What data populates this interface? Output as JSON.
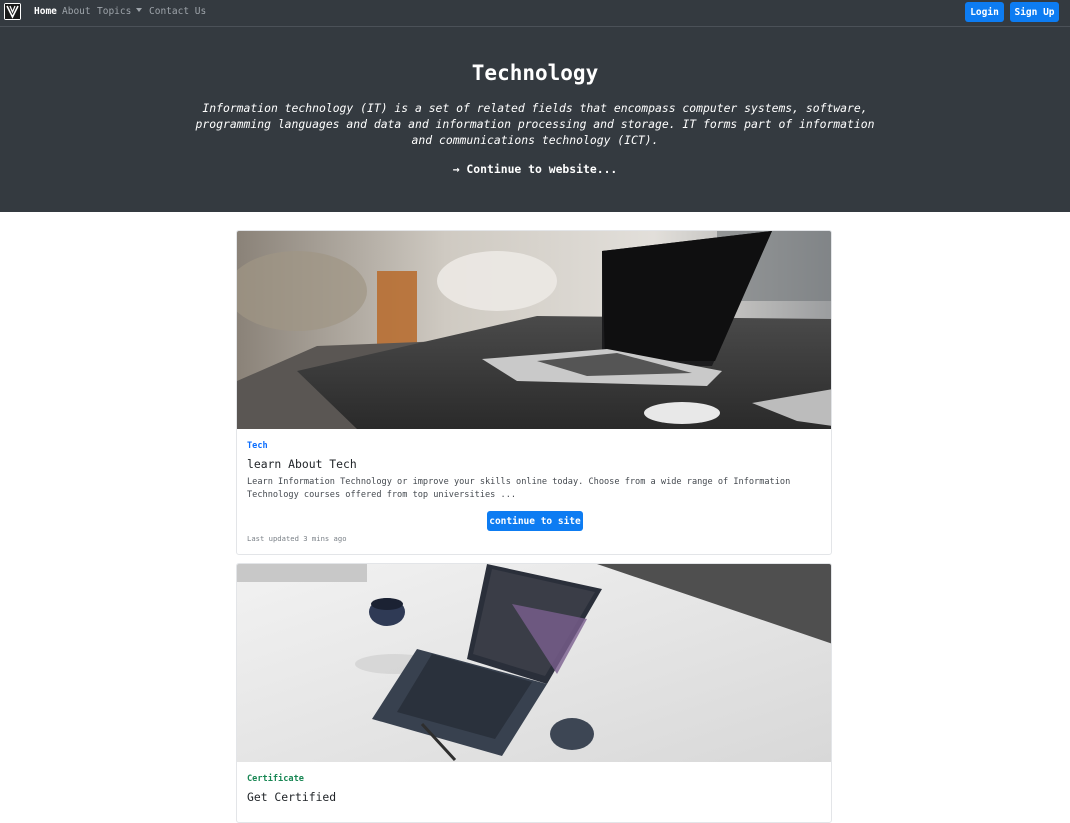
{
  "navbar": {
    "links": [
      {
        "label": "Home"
      },
      {
        "label": "About"
      },
      {
        "label": "Topics"
      },
      {
        "label": "Contact Us"
      }
    ],
    "login_label": "Login",
    "signup_label": "Sign Up"
  },
  "hero": {
    "title": "Technology",
    "lead": "Information technology (IT) is a set of related fields that encompass computer systems, software, programming languages and data and information processing and storage. IT forms part of information and communications technology (ICT).",
    "link_label": "→ Continue to website..."
  },
  "cards": [
    {
      "tag": "Tech",
      "tag_color": "#0d6efd",
      "title": "learn About Tech",
      "text": "Learn Information Technology or improve your skills online today. Choose from a wide range of Information Technology courses offered from top universities ...",
      "button_label": "continue to site",
      "updated": "Last updated 3 mins ago"
    },
    {
      "tag": "Certificate",
      "tag_color": "#198754",
      "title": "Get Certified"
    }
  ],
  "colors": {
    "navbar_bg": "#343a40",
    "primary": "#0d7cf2"
  }
}
